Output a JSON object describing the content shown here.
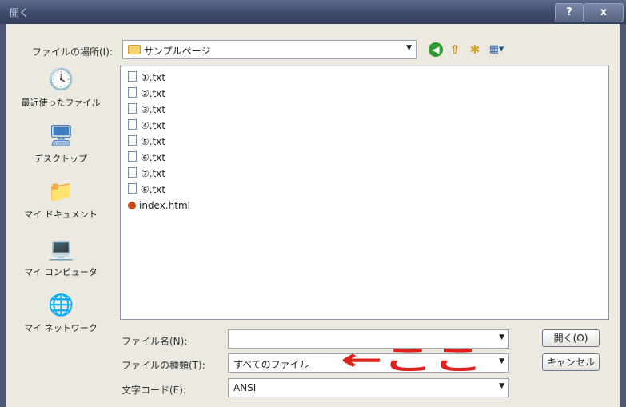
{
  "window": {
    "title": "開く",
    "help_label": "?",
    "close_label": "x"
  },
  "toolbar": {
    "lookin_label": "ファイルの場所(I):",
    "lookin_value": "サンプルページ",
    "back_icon": "back-arrow-icon",
    "up_icon": "up-folder-icon",
    "newfolder_icon": "new-folder-icon",
    "view_icon": "view-menu-icon"
  },
  "places": [
    {
      "label": "最近使ったファイル",
      "icon": "recent-files-icon"
    },
    {
      "label": "デスクトップ",
      "icon": "desktop-icon"
    },
    {
      "label": "マイ ドキュメント",
      "icon": "my-documents-icon"
    },
    {
      "label": "マイ コンピュータ",
      "icon": "my-computer-icon"
    },
    {
      "label": "マイ ネットワーク",
      "icon": "my-network-icon"
    }
  ],
  "files": [
    {
      "name": "①.txt",
      "type": "text"
    },
    {
      "name": "②.txt",
      "type": "text"
    },
    {
      "name": "③.txt",
      "type": "text"
    },
    {
      "name": "④.txt",
      "type": "text"
    },
    {
      "name": "⑤.txt",
      "type": "text"
    },
    {
      "name": "⑥.txt",
      "type": "text"
    },
    {
      "name": "⑦.txt",
      "type": "text"
    },
    {
      "name": "⑧.txt",
      "type": "text"
    },
    {
      "name": "index.html",
      "type": "html"
    }
  ],
  "form": {
    "filename_label": "ファイル名(N):",
    "filename_value": "",
    "filetype_label": "ファイルの種類(T):",
    "filetype_value": "すべてのファイル",
    "encoding_label": "文字コード(E):",
    "encoding_value": "ANSI"
  },
  "buttons": {
    "open_label": "開く(O)",
    "cancel_label": "キャンセル"
  },
  "annotation": {
    "text": "←ここ",
    "color": "#e0201a"
  }
}
